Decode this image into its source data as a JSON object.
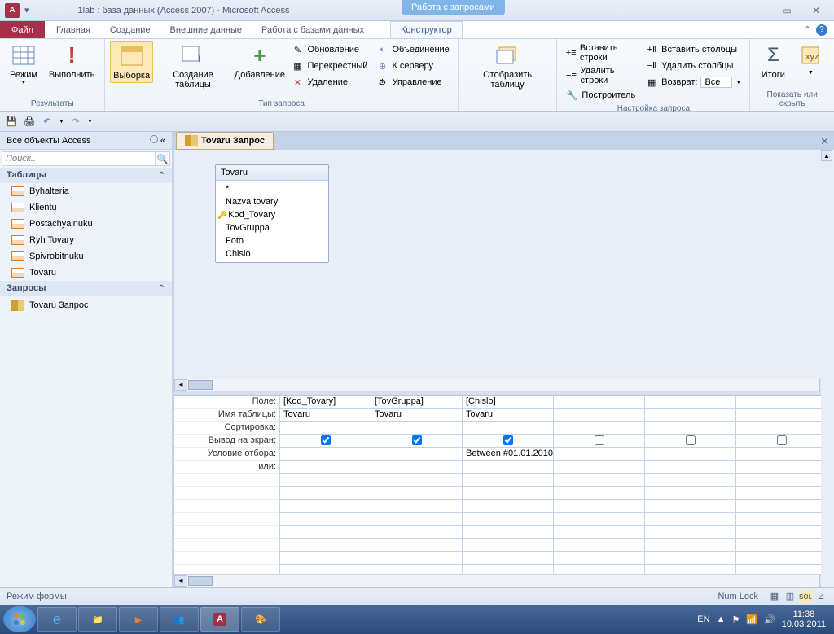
{
  "title": "1lab : база данных (Access 2007)  -  Microsoft Access",
  "context_tab": "Работа с запросами",
  "menu": {
    "file": "Файл",
    "tabs": [
      "Главная",
      "Создание",
      "Внешние данные",
      "Работа с базами данных"
    ],
    "active": "Конструктор"
  },
  "ribbon": {
    "g1": {
      "label": "Результаты",
      "btns": [
        "Режим",
        "Выполнить"
      ]
    },
    "g2": {
      "label": "Тип запроса",
      "big": [
        "Выборка",
        "Создание таблицы",
        "Добавление"
      ],
      "sm": [
        "Обновление",
        "Перекрестный",
        "Удаление",
        "Объединение",
        "К серверу",
        "Управление"
      ]
    },
    "g3": {
      "label": "",
      "big": "Отобразить таблицу"
    },
    "g4": {
      "label": "Настройка запроса",
      "rows": [
        "Вставить строки",
        "Удалить строки",
        "Построитель"
      ],
      "cols": [
        "Вставить столбцы",
        "Удалить столбцы"
      ],
      "ret": "Возврат:",
      "retval": "Все"
    },
    "g5": {
      "label": "Показать или скрыть",
      "btns": [
        "Итоги",
        ""
      ]
    }
  },
  "nav": {
    "title": "Все объекты Access",
    "search": "Поиск..",
    "groups": {
      "tables": "Таблицы",
      "queries": "Запросы"
    },
    "tables": [
      "Byhalteria",
      "Klientu",
      "Postachyalnuku",
      "Ryh Tovary",
      "Spivrobitnuku",
      "Tovaru"
    ],
    "queries": [
      "Tovaru Запрос"
    ]
  },
  "doc": {
    "tab": "Tovaru Запрос"
  },
  "tablebox": {
    "title": "Tovaru",
    "fields": [
      "*",
      "Nazva tovary",
      "Kod_Tovary",
      "TovGruppa",
      "Foto",
      "Chislo"
    ],
    "key_idx": 2
  },
  "grid": {
    "labels": [
      "Поле:",
      "Имя таблицы:",
      "Сортировка:",
      "Вывод на экран:",
      "Условие отбора:",
      "или:"
    ],
    "cols": [
      {
        "field": "[Kod_Tovary]",
        "table": "Tovaru",
        "show": true,
        "crit": ""
      },
      {
        "field": "[TovGruppa]",
        "table": "Tovaru",
        "show": true,
        "crit": ""
      },
      {
        "field": "[Chislo]",
        "table": "Tovaru",
        "show": true,
        "crit": "Between #01.01.2010"
      },
      {
        "field": "",
        "table": "",
        "show": false,
        "crit": ""
      },
      {
        "field": "",
        "table": "",
        "show": false,
        "crit": ""
      },
      {
        "field": "",
        "table": "",
        "show": false,
        "crit": ""
      }
    ]
  },
  "status": {
    "mode": "Режим формы",
    "numlock": "Num Lock"
  },
  "tray": {
    "lang": "EN",
    "time": "11:38",
    "date": "10.03.2011"
  }
}
